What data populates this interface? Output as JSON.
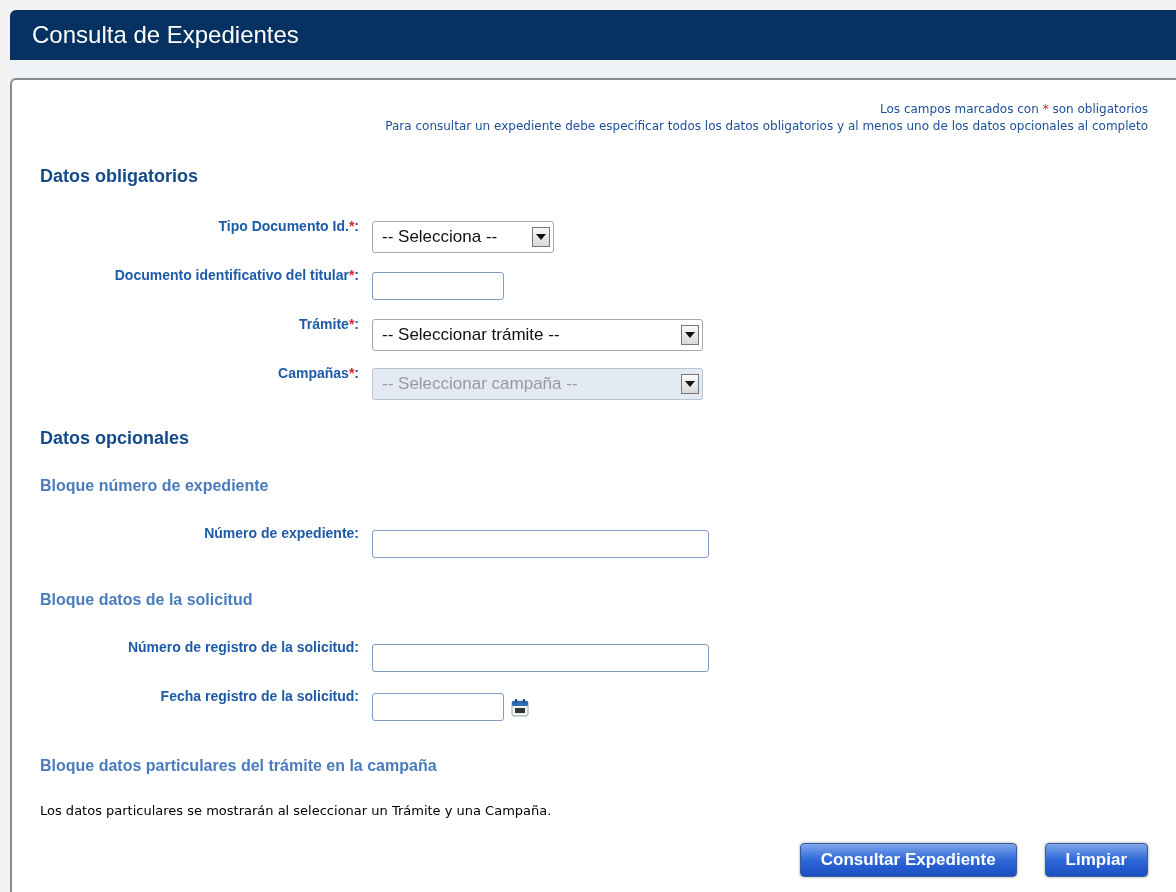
{
  "title": "Consulta de Expedientes",
  "notes": [
    {
      "before": "Los campos marcados con",
      "mark": "*",
      "after": "son obligatorios"
    },
    {
      "before": "Para consultar un expediente debe especificar todos los datos obligatorios y al menos uno de los datos opcionales al completo"
    }
  ],
  "sections": [
    {
      "heading": "Datos obligatorios",
      "blocks": [
        {
          "fields": [
            {
              "kind": "short-select",
              "label": "Tipo Documento Id.",
              "mark": "*",
              "colon": ":",
              "value": "-- Selecciona --",
              "disabled": false
            },
            {
              "kind": "short-text",
              "label": "Documento identificativo del titular",
              "mark": "*",
              "colon": ":",
              "disabled": false
            },
            {
              "kind": "select",
              "label": "Trámite",
              "mark": "*",
              "colon": ":",
              "value": "-- Seleccionar trámite --",
              "disabled": false
            },
            {
              "kind": "select",
              "label": "Campañas",
              "mark": "*",
              "colon": ":",
              "value": "-- Seleccionar campaña --",
              "disabled": true
            }
          ]
        }
      ]
    },
    {
      "heading": "Datos opcionales",
      "blocks": [
        {
          "title": "Bloque número de expediente",
          "fields": [
            {
              "kind": "text",
              "label": "Número de expediente:",
              "disabled": false
            }
          ]
        },
        {
          "title": "Bloque datos de la solicitud",
          "fields": [
            {
              "kind": "text",
              "label": "Número de registro de la solicitud:",
              "disabled": false
            },
            {
              "kind": "date",
              "label": "Fecha registro de la solicitud:",
              "disabled": false
            }
          ]
        },
        {
          "title": "Bloque datos particulares del trámite en la campaña",
          "text": "Los datos particulares se mostrarán al seleccionar un Trámite y una Campaña."
        }
      ]
    }
  ],
  "buttons": [
    "Consultar Expediente",
    "Limpiar"
  ]
}
